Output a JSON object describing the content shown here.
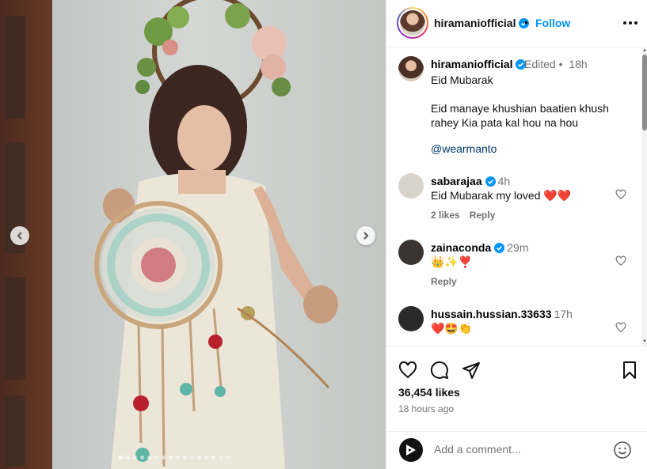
{
  "post": {
    "username": "hiramaniofficial",
    "dot": "•",
    "follow_label": "Follow",
    "more_icon": "more-horizontal-icon",
    "caption": {
      "username": "hiramaniofficial",
      "edited": "Edited",
      "separator": "•",
      "time": "18h",
      "line1": "Eid Mubarak",
      "line2": "Eid manaye khushian baatien khush rahey Kia pata kal hou na hou",
      "mention": "@wearmanto"
    },
    "comments": [
      {
        "username": "sabarajaa",
        "verified": true,
        "time": "4h",
        "text": "Eid Mubarak my loved ❤️❤️",
        "likes": "2 likes",
        "reply": "Reply",
        "avatar_color": "#d8d4cc"
      },
      {
        "username": "zainaconda",
        "verified": true,
        "time": "29m",
        "text": "👑✨❣️",
        "likes": "",
        "reply": "Reply",
        "avatar_color": "#3b3430"
      },
      {
        "username": "hussain.hussian.33633",
        "verified": false,
        "time": "17h",
        "text": "❤️🤩👏",
        "likes": "",
        "reply": "",
        "avatar_color": "#2a2a2a"
      }
    ],
    "likes": "36,454 likes",
    "posted": "18 hours ago",
    "add_comment_placeholder": "Add a comment...",
    "carousel": {
      "count": 16,
      "active_index": 0
    },
    "colors": {
      "accent": "#0095f6",
      "mention": "#00376b",
      "muted": "#737373",
      "heart": "#e0143c"
    }
  }
}
